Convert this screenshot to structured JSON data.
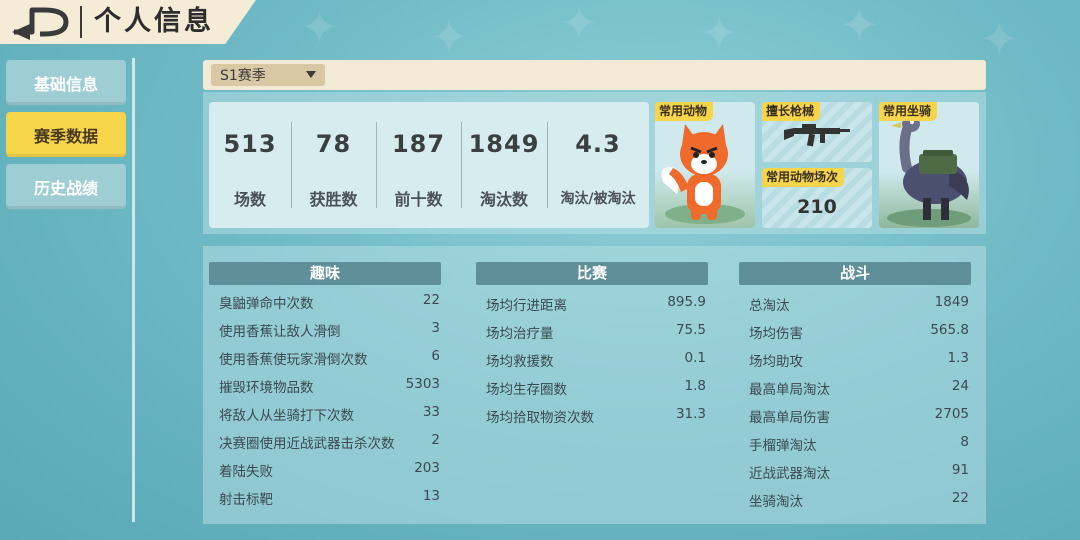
{
  "header": {
    "title": "个人信息"
  },
  "sidebar": {
    "items": [
      {
        "label": "基础信息",
        "active": false
      },
      {
        "label": "赛季数据",
        "active": true
      },
      {
        "label": "历史战绩",
        "active": false
      }
    ]
  },
  "season": {
    "selected": "S1赛季"
  },
  "summary": [
    {
      "value": "513",
      "label": "场数"
    },
    {
      "value": "78",
      "label": "获胜数"
    },
    {
      "value": "187",
      "label": "前十数"
    },
    {
      "value": "1849",
      "label": "淘汰数"
    },
    {
      "value": "4.3",
      "label": "淘汰/被淘汰"
    }
  ],
  "cards": {
    "animal_tag": "常用动物",
    "weapon_tag": "擅长枪械",
    "count_tag": "常用动物场次",
    "count_value": "210",
    "mount_tag": "常用坐骑"
  },
  "columns": {
    "fun": {
      "title": "趣味",
      "rows": [
        {
          "k": "臭鼬弹命中次数",
          "v": "22"
        },
        {
          "k": "使用香蕉让敌人滑倒",
          "v": "3"
        },
        {
          "k": "使用香蕉使玩家滑倒次数",
          "v": "6"
        },
        {
          "k": "摧毁环境物品数",
          "v": "5303"
        },
        {
          "k": "将敌人从坐骑打下次数",
          "v": "33"
        },
        {
          "k": "决赛圈使用近战武器击杀次数",
          "v": "2"
        },
        {
          "k": "着陆失败",
          "v": "203"
        },
        {
          "k": "射击标靶",
          "v": "13"
        }
      ]
    },
    "match": {
      "title": "比赛",
      "rows": [
        {
          "k": "场均行进距离",
          "v": "895.9"
        },
        {
          "k": "场均治疗量",
          "v": "75.5"
        },
        {
          "k": "场均救援数",
          "v": "0.1"
        },
        {
          "k": "场均生存圈数",
          "v": "1.8"
        },
        {
          "k": "场均拾取物资次数",
          "v": "31.3"
        }
      ]
    },
    "combat": {
      "title": "战斗",
      "rows": [
        {
          "k": "总淘汰",
          "v": "1849"
        },
        {
          "k": "场均伤害",
          "v": "565.8"
        },
        {
          "k": "场均助攻",
          "v": "1.3"
        },
        {
          "k": "最高单局淘汰",
          "v": "24"
        },
        {
          "k": "最高单局伤害",
          "v": "2705"
        },
        {
          "k": "手榴弹淘汰",
          "v": "8"
        },
        {
          "k": "近战武器淘汰",
          "v": "91"
        },
        {
          "k": "坐骑淘汰",
          "v": "22"
        }
      ]
    }
  },
  "colors": {
    "accent": "#f7d54a",
    "header_bar": "#5f8f98",
    "panel": "#d7ecee"
  },
  "icons": {
    "back": "back-arrow-icon",
    "dropdown": "chevron-down-icon"
  }
}
